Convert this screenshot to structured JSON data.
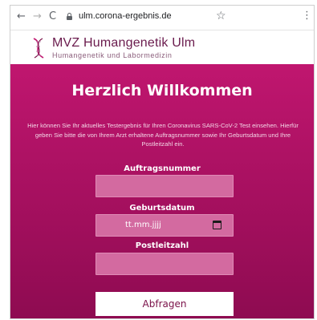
{
  "browser": {
    "url": "ulm.corona-ergebnis.de",
    "back_icon": "←",
    "forward_icon": "→",
    "reload_icon": "C",
    "star_icon": "☆",
    "menu_icon": "⋮"
  },
  "header": {
    "name": "MVZ Humangenetik Ulm",
    "subtitle": "Humangenetik und Labormedizin"
  },
  "main": {
    "title": "Herzlich Willkommen",
    "intro": "Hier können Sie Ihr aktuelles Testergebnis für Ihren Coronavirus SARS-CoV-2 Test einsehen. Hierfür geben Sie bitte die von Ihrem Arzt erhaltene Auftragsnummer sowie Ihr Geburtsdatum und Ihre Postleitzahl ein.",
    "fields": {
      "order_label": "Auftragsnummer",
      "order_value": "",
      "birth_label": "Geburtsdatum",
      "birth_placeholder": "tt.mm.jjjj",
      "zip_label": "Postleitzahl",
      "zip_value": ""
    },
    "submit_label": "Abfragen"
  },
  "colors": {
    "accent": "#c0166f",
    "accent_dark": "#8e0b51",
    "field_bg": "#d36aa0",
    "brand_text": "#6a1b4d"
  }
}
